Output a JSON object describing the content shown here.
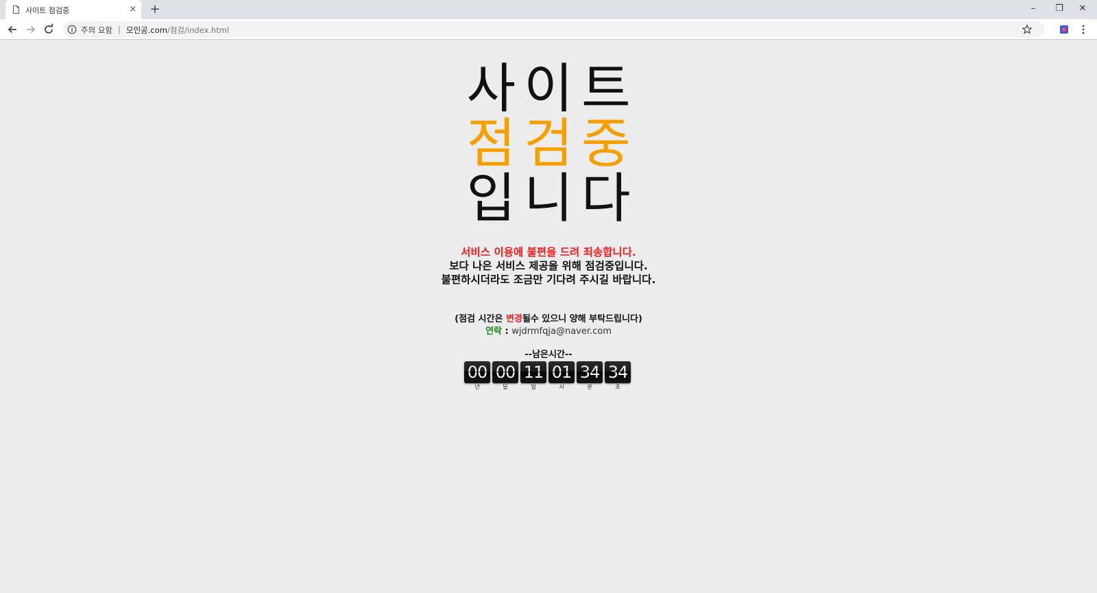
{
  "browser": {
    "tab_title": "사이트 점검중",
    "tab_close": "×",
    "new_tab": "+",
    "window_controls": {
      "minimize": "–",
      "restore": "❐",
      "close": "✕"
    },
    "address": {
      "security_label": "주의 요함",
      "separator": "|",
      "host": "모인공.com",
      "path": "/점검/index.html"
    },
    "icons": [
      "page-icon",
      "back-icon",
      "forward-icon",
      "reload-icon",
      "info-icon",
      "star-icon",
      "extension-icon",
      "menu-icon"
    ]
  },
  "page": {
    "headline": [
      "사이트",
      "점검중",
      "입니다"
    ],
    "messages": [
      "서비스 이용에 불편을 드려 죄송합니다.",
      "보다 나은 서비스 제공을 위해 점검중입니다.",
      "불편하시더라도 조금만 기다려 주시길 바랍니다."
    ],
    "notice": {
      "before": "(점검 시간은 ",
      "highlight": "변경",
      "after": "될수 있으니 양해 부탁드립니다)"
    },
    "contact": {
      "label": "연락",
      "colon": " : ",
      "email": "wjdrmfqja@naver.com"
    },
    "remaining_title": "--남은시간--",
    "countdown": [
      {
        "value": "00",
        "unit": "년"
      },
      {
        "value": "00",
        "unit": "달"
      },
      {
        "value": "11",
        "unit": "일"
      },
      {
        "value": "01",
        "unit": "시"
      },
      {
        "value": "34",
        "unit": "분"
      },
      {
        "value": "34",
        "unit": "초"
      }
    ]
  },
  "colors": {
    "accent_orange": "#f5a000",
    "alert_red": "#ff1a1a",
    "contact_green": "#1a8a1a",
    "page_background": "#ececec"
  }
}
